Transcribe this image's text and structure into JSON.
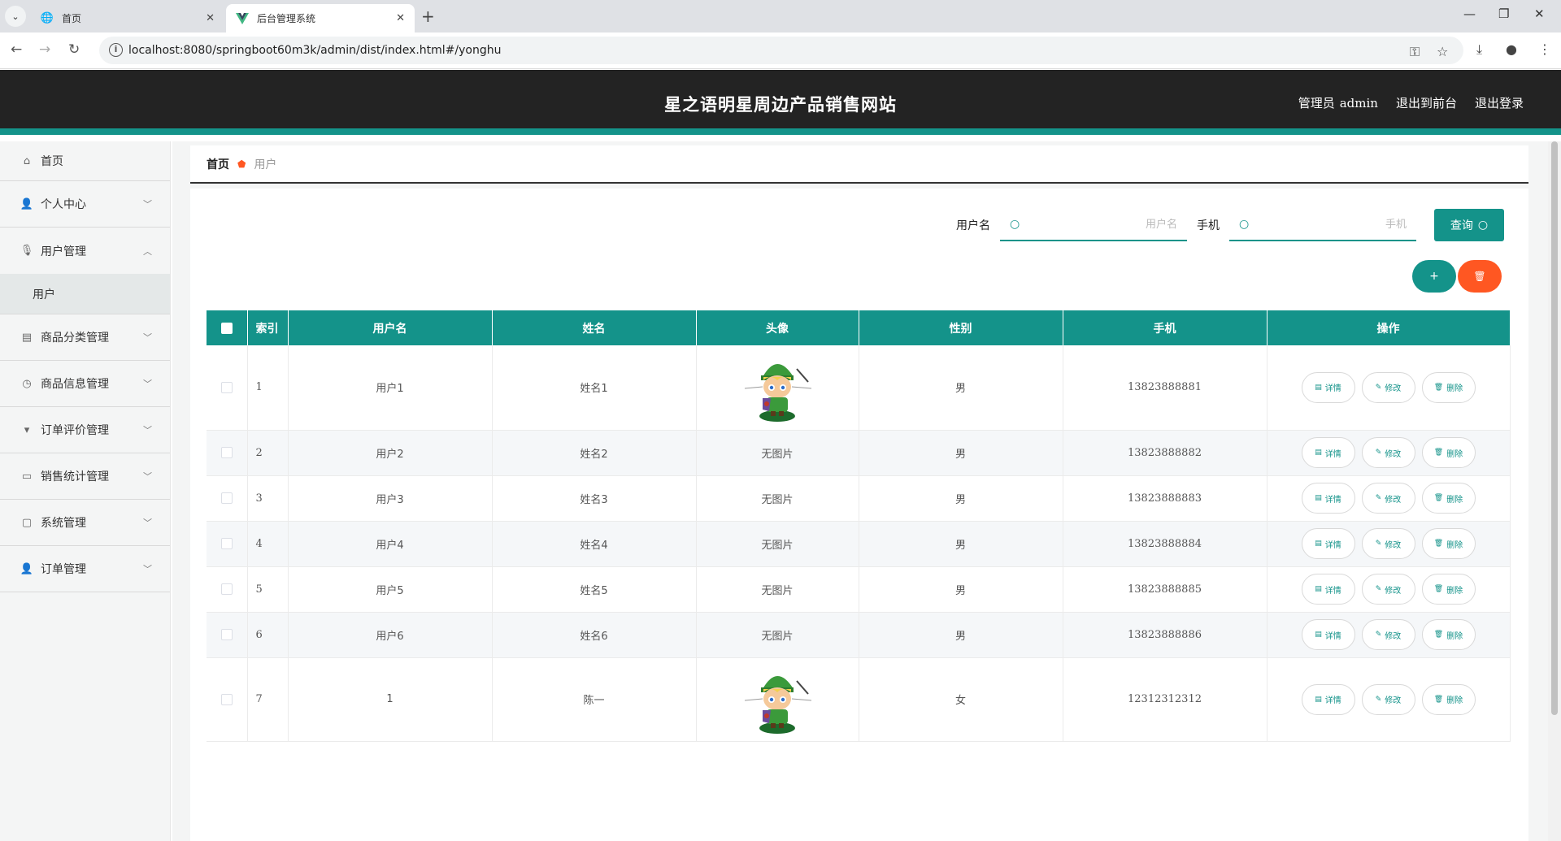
{
  "browser": {
    "tabs": [
      {
        "title": "首页",
        "icon": "globe-icon"
      },
      {
        "title": "后台管理系统",
        "icon": "vue-logo-icon"
      }
    ],
    "url": "localhost:8080/springboot60m3k/admin/dist/index.html#/yonghu"
  },
  "header": {
    "title": "星之语明星周边产品销售网站",
    "role": "管理员",
    "username": "admin",
    "back_to_front": "退出到前台",
    "logout": "退出登录"
  },
  "sidebar": {
    "items": [
      {
        "label": "首页",
        "icon": "home-icon"
      },
      {
        "label": "个人中心",
        "icon": "user-icon"
      },
      {
        "label": "用户管理",
        "icon": "microphone-icon"
      },
      {
        "label": "用户",
        "sub": true
      },
      {
        "label": "商品分类管理",
        "icon": "trash-icon"
      },
      {
        "label": "商品信息管理",
        "icon": "clock-icon"
      },
      {
        "label": "订单评价管理",
        "icon": "brush-icon"
      },
      {
        "label": "销售统计管理",
        "icon": "card-icon"
      },
      {
        "label": "系统管理",
        "icon": "chat-icon"
      },
      {
        "label": "订单管理",
        "icon": "user-icon"
      }
    ]
  },
  "breadcrumb": {
    "home": "首页",
    "current": "用户"
  },
  "search": {
    "username_label": "用户名",
    "username_placeholder": "用户名",
    "phone_label": "手机",
    "phone_placeholder": "手机",
    "query_label": "查询"
  },
  "actions": {
    "add": "+",
    "delete": "🗑"
  },
  "table": {
    "headers": [
      "索引",
      "用户名",
      "姓名",
      "头像",
      "性别",
      "手机",
      "操作"
    ],
    "op_labels": {
      "detail": "详情",
      "edit": "修改",
      "delete": "删除"
    },
    "no_image": "无图片",
    "rows": [
      {
        "index": "1",
        "username": "用户1",
        "name": "姓名1",
        "avatar": "image",
        "gender": "男",
        "phone": "13823888881"
      },
      {
        "index": "2",
        "username": "用户2",
        "name": "姓名2",
        "avatar": "none",
        "gender": "男",
        "phone": "13823888882"
      },
      {
        "index": "3",
        "username": "用户3",
        "name": "姓名3",
        "avatar": "none",
        "gender": "男",
        "phone": "13823888883"
      },
      {
        "index": "4",
        "username": "用户4",
        "name": "姓名4",
        "avatar": "none",
        "gender": "男",
        "phone": "13823888884"
      },
      {
        "index": "5",
        "username": "用户5",
        "name": "姓名5",
        "avatar": "none",
        "gender": "男",
        "phone": "13823888885"
      },
      {
        "index": "6",
        "username": "用户6",
        "name": "姓名6",
        "avatar": "none",
        "gender": "男",
        "phone": "13823888886"
      },
      {
        "index": "7",
        "username": "1",
        "name": "陈一",
        "avatar": "image",
        "gender": "女",
        "phone": "12312312312"
      }
    ]
  },
  "colors": {
    "accent": "#14938a",
    "danger": "#ff5722",
    "header_bg": "#232323"
  }
}
